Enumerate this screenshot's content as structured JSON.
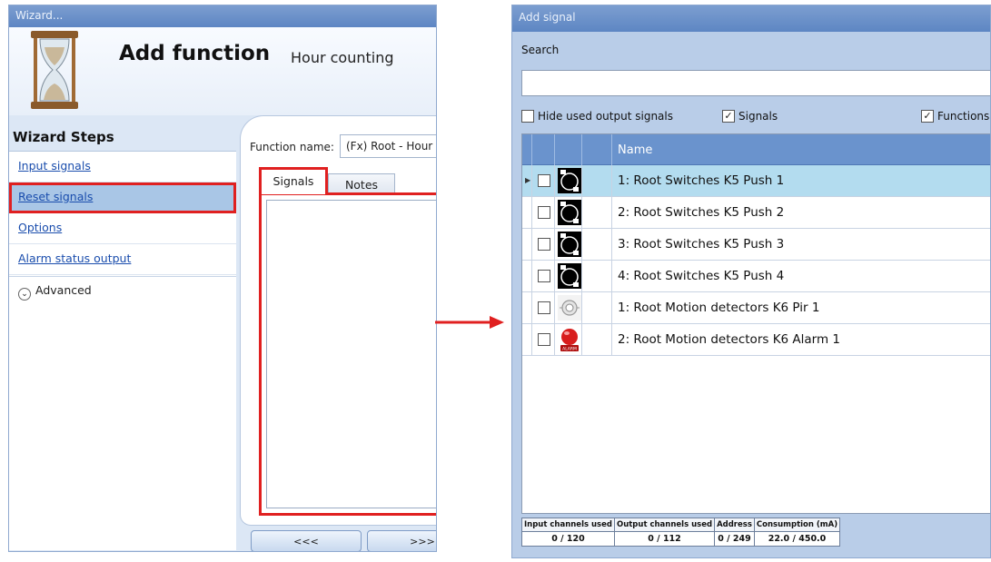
{
  "wizard": {
    "window_title": "Wizard...",
    "heading": "Add function",
    "subheading": "Hour counting",
    "steps_title": "Wizard Steps",
    "steps": [
      {
        "label": "Input signals"
      },
      {
        "label": "Reset signals"
      },
      {
        "label": "Options"
      },
      {
        "label": "Alarm status output"
      }
    ],
    "advanced_label": "Advanced",
    "function_name_label": "Function name:",
    "function_name_value": "(Fx) Root - Hour counting",
    "tabs": [
      {
        "label": "Signals"
      },
      {
        "label": "Notes"
      }
    ],
    "back_button": "<<<",
    "next_button": ">>>"
  },
  "add_signal": {
    "window_title": "Add signal",
    "search_label": "Search",
    "search_value": "",
    "filters": [
      {
        "label": "Hide used output signals",
        "checked": false
      },
      {
        "label": "Signals",
        "checked": true
      },
      {
        "label": "Functions",
        "checked": true
      }
    ],
    "column_name": "Name",
    "rows": [
      {
        "name": "1: Root Switches K5 Push 1",
        "icon": "push-button-icon",
        "selected": true
      },
      {
        "name": "2: Root Switches K5 Push 2",
        "icon": "push-button-icon",
        "selected": false
      },
      {
        "name": "3: Root Switches K5 Push 3",
        "icon": "push-button-icon",
        "selected": false
      },
      {
        "name": "4: Root Switches K5 Push 4",
        "icon": "push-button-icon",
        "selected": false
      },
      {
        "name": "1: Root Motion detectors K6 Pir 1",
        "icon": "pir-sensor-icon",
        "selected": false
      },
      {
        "name": "2: Root Motion detectors K6 Alarm 1",
        "icon": "alarm-icon",
        "selected": false
      }
    ],
    "stats": {
      "headers": [
        "Input channels used",
        "Output channels used",
        "Address",
        "Consumption (mA)"
      ],
      "values": [
        "0 / 120",
        "0 / 112",
        "0 / 249",
        "22.0 / 450.0"
      ]
    }
  },
  "colors": {
    "highlight_border": "#e02020",
    "selected_row": "#b3dcef",
    "grid_header": "#6a93cd"
  }
}
